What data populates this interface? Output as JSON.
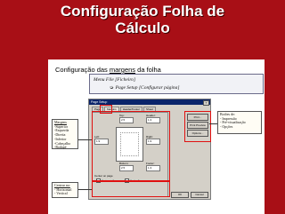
{
  "slide": {
    "title_line1": "Configuração Folha de",
    "title_line2": "Cálculo"
  },
  "panel": {
    "heading_prefix": "Configuração das ",
    "heading_keyword": "margens",
    "heading_suffix": " da folha",
    "menu_line1": "Menu File [Ficheiro]",
    "menu_line2": "Page Setup [Configurar página]",
    "arrow_icon": "➭"
  },
  "dialog": {
    "title": "Page Setup",
    "close": "?",
    "tabs": [
      "Page",
      "Margins",
      "Header/Footer",
      "Sheet"
    ],
    "labels": {
      "top": "Top:",
      "header": "Header:",
      "left": "Left:",
      "right": "Right:",
      "bottom": "Bottom:",
      "footer": "Footer:",
      "center_on_page": "Center on page",
      "horizontally": "Horizontally",
      "vertically": "Vertically"
    },
    "values": {
      "top": "2.5",
      "header": "1.3",
      "left": "1.9",
      "right": "1.9",
      "bottom": "2.5",
      "footer": "1.3"
    },
    "buttons": {
      "print": "Print...",
      "print_preview": "Print Preview",
      "options": "Options...",
      "ok": "OK",
      "cancel": "Cancel"
    }
  },
  "notes": {
    "margens": {
      "title": "Margens",
      "items": [
        "-Superior",
        "-Esquerda",
        "-Direita",
        "-Inferior",
        "-Cabeçalho",
        "-Rodapé"
      ]
    },
    "centrar": {
      "title": "Centrar na:",
      "items": [
        "- Horizontal",
        "- Vertical"
      ]
    },
    "botoes": {
      "title": "Botões de:",
      "items": [
        "- Impressão",
        "- Pré-visualização",
        "- Opções"
      ]
    }
  },
  "colors": {
    "slide_background": "#a80f16",
    "highlight": "#e01010"
  }
}
